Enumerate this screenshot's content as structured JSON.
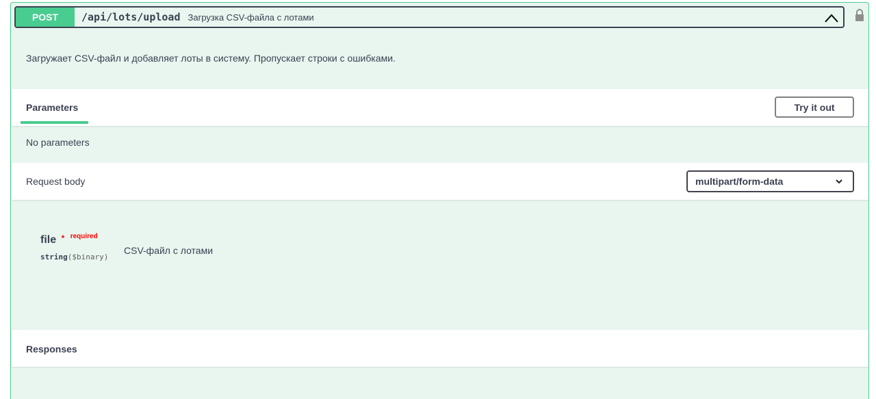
{
  "operation": {
    "method": "POST",
    "path": "/api/lots/upload",
    "summary": "Загрузка CSV-файла с лотами",
    "description": "Загружает CSV-файл и добавляет лоты в систему. Пропускает строки с ошибками.",
    "collapse_icon": "chevron-up-icon",
    "lock_icon": "lock-icon"
  },
  "parameters": {
    "title": "Parameters",
    "try_label": "Try it out",
    "empty_text": "No parameters"
  },
  "request_body": {
    "title": "Request body",
    "content_type": "multipart/form-data",
    "field": {
      "name": "file",
      "star": "*",
      "required_label": "required",
      "type": "string",
      "format": "($binary)",
      "description": "CSV-файл с лотами"
    }
  },
  "responses": {
    "title": "Responses"
  },
  "colors": {
    "accent": "#49cc90",
    "background": "#e8f6ef",
    "text": "#3b4151",
    "required": "#ff0000"
  }
}
